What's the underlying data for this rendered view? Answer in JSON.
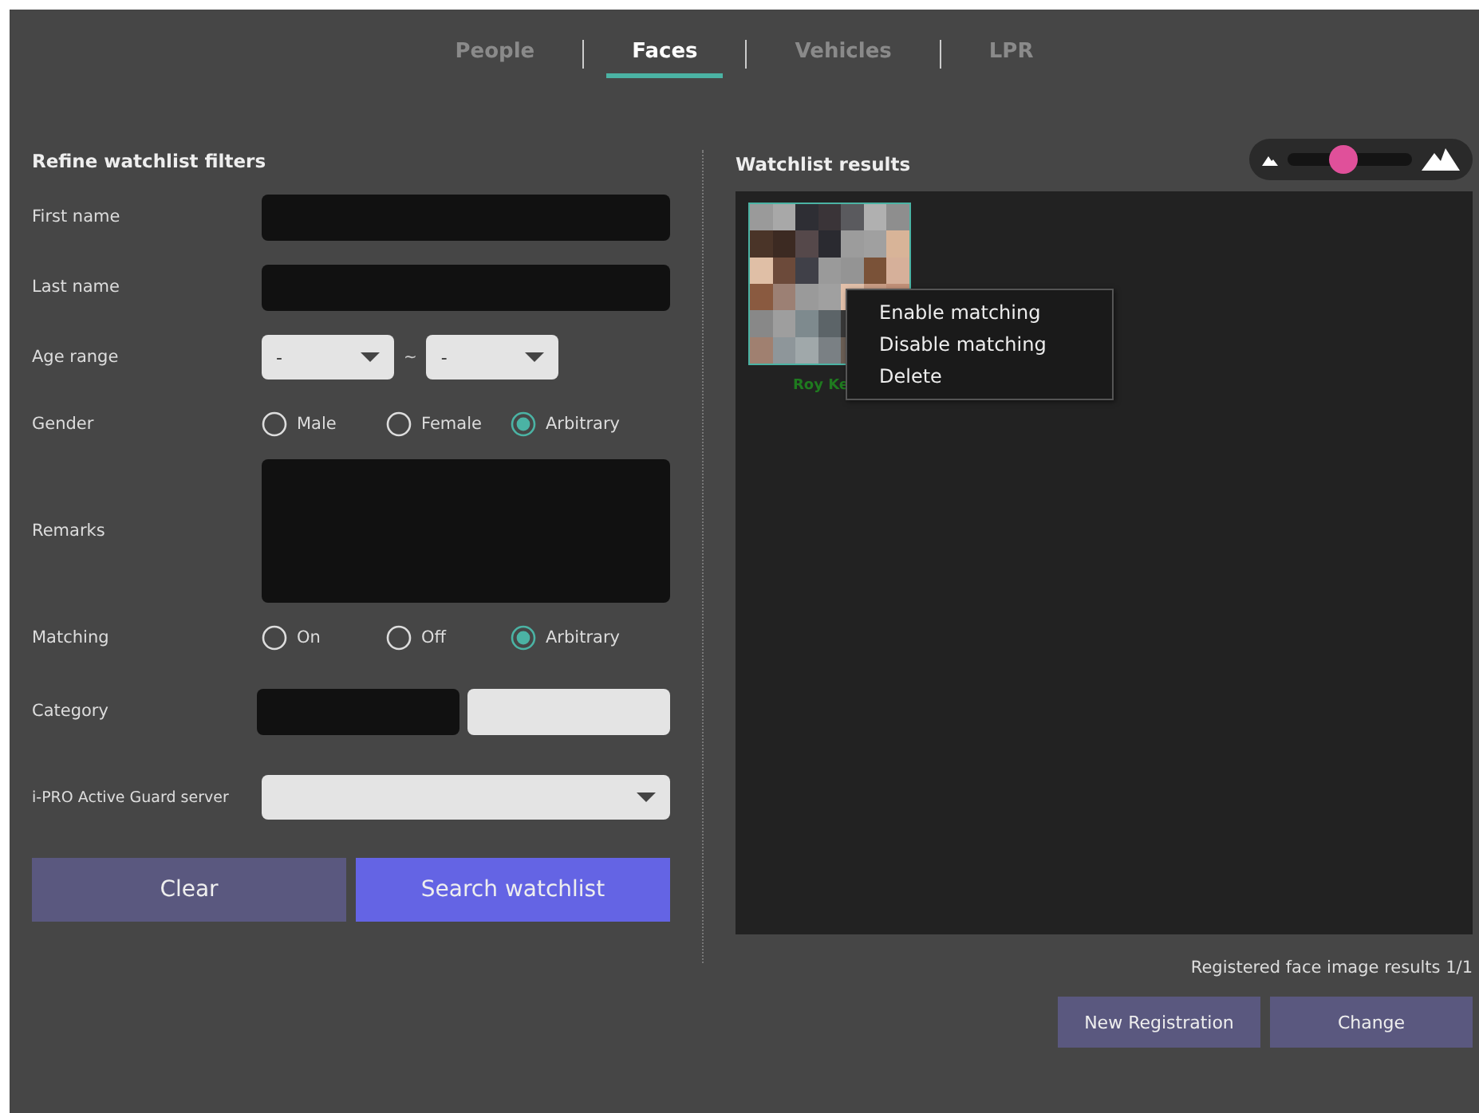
{
  "tabs": [
    {
      "label": "People",
      "selected": false
    },
    {
      "label": "Faces",
      "selected": true
    },
    {
      "label": "Vehicles",
      "selected": false
    },
    {
      "label": "LPR",
      "selected": false
    }
  ],
  "filters": {
    "title": "Refine watchlist filters",
    "rows": [
      {
        "kind": "text",
        "label": "First name"
      },
      {
        "kind": "text",
        "label": "Last name"
      },
      {
        "kind": "range",
        "label": "Age range",
        "from": "-",
        "separator": "~",
        "to": "-"
      },
      {
        "kind": "radio",
        "label": "Gender",
        "options": [
          {
            "label": "Male",
            "selected": false
          },
          {
            "label": "Female",
            "selected": false
          },
          {
            "label": "Arbitrary",
            "selected": true
          }
        ]
      },
      {
        "kind": "textarea",
        "label": "Remarks"
      },
      {
        "kind": "radio",
        "label": "Matching",
        "options": [
          {
            "label": "On",
            "selected": false
          },
          {
            "label": "Off",
            "selected": false
          },
          {
            "label": "Arbitrary",
            "selected": true
          }
        ]
      },
      {
        "kind": "category",
        "label": "Category"
      },
      {
        "kind": "dropdown",
        "label": "i-PRO Active Guard server"
      }
    ],
    "buttons": [
      {
        "label": "Clear",
        "kind": "secondary"
      },
      {
        "label": "Search watchlist",
        "kind": "primary"
      }
    ]
  },
  "results": {
    "title": "Watchlist results",
    "size_slider": {
      "level": 0.45
    },
    "items": [
      {
        "kind": "picture",
        "name": "Roy Ke"
      }
    ],
    "context_menu": [
      "Enable matching",
      "Disable matching",
      "Delete"
    ],
    "count": "Registered face image results 1/1",
    "buttons": [
      "New Registration",
      "Change"
    ]
  }
}
